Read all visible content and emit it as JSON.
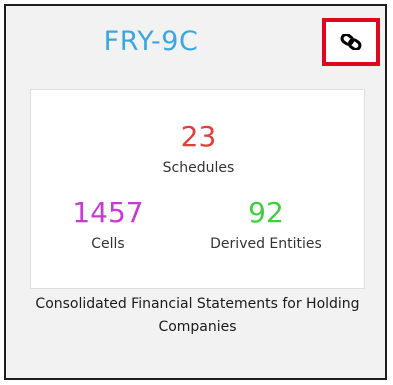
{
  "card": {
    "title": "FRY-9C",
    "link_icon": "link-icon",
    "stats": {
      "schedules": {
        "value": "23",
        "label": "Schedules"
      },
      "cells": {
        "value": "1457",
        "label": "Cells"
      },
      "derived": {
        "value": "92",
        "label": "Derived Entities"
      }
    },
    "description": "Consolidated Financial Statements for Holding Companies"
  },
  "colors": {
    "title": "#3aa8e0",
    "schedules": "#e0403a",
    "cells": "#c53bd3",
    "derived": "#3fcf3f",
    "highlight_border": "#e0061b"
  }
}
